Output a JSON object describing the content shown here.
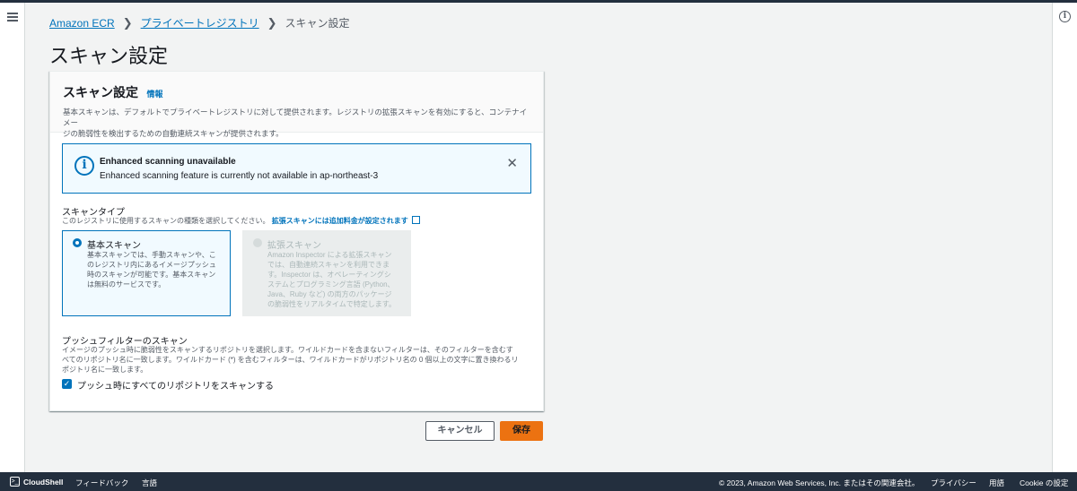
{
  "breadcrumb": {
    "root": "Amazon ECR",
    "parent": "プライベートレジストリ",
    "current": "スキャン設定"
  },
  "page_title": "スキャン設定",
  "card": {
    "title": "スキャン設定",
    "info_link": "情報",
    "desc_line1": "基本スキャンは、デフォルトでプライベートレジストリに対して提供されます。レジストリの拡張スキャンを有効にすると、コンテナイメー",
    "desc_line2": "ジの脆弱性を検出するための自動連続スキャンが提供されます。"
  },
  "alert": {
    "title": "Enhanced scanning unavailable",
    "message": "Enhanced scanning feature is currently not available in ap-northeast-3"
  },
  "scan_type": {
    "label": "スキャンタイプ",
    "desc": "このレジストリに使用するスキャンの種類を選択してください。",
    "link": "拡張スキャンには追加料金が設定されます",
    "basic": {
      "label": "基本スキャン",
      "line1": "基本スキャンでは、手動スキャンや、こ",
      "line2": "のレジストリ内にあるイメージプッシュ",
      "line3": "時のスキャンが可能です。基本スキャン",
      "line4": "は無料のサービスです。",
      "selected": true
    },
    "enhanced": {
      "label": "拡張スキャン",
      "line1": "Amazon Inspector による拡張スキャン",
      "line2": "では、自動連続スキャンを利用できま",
      "line3": "す。Inspector は、オペレーティングシ",
      "line4": "ステムとプログラミング言語 (Python、",
      "line5": "Java、Ruby など) の両方のパッケージ",
      "line6": "の脆弱性をリアルタイムで特定します。",
      "disabled": true
    }
  },
  "push_filter": {
    "label": "プッシュフィルターのスキャン",
    "line1": "イメージのプッシュ時に脆弱性をスキャンするリポジトリを選択します。ワイルドカードを含まないフィルターは、そのフィルターを含むす",
    "line2": "べてのリポジトリ名に一致します。ワイルドカード (*) を含むフィルターは、ワイルドカードがリポジトリ名の 0 個以上の文字に置き換わるリ",
    "line3": "ポジトリ名に一致します。",
    "checkbox_label": "プッシュ時にすべてのリポジトリをスキャンする",
    "checked": true
  },
  "buttons": {
    "cancel": "キャンセル",
    "save": "保存"
  },
  "footer": {
    "cloudshell": "CloudShell",
    "feedback": "フィードバック",
    "language": "言語",
    "copyright": "© 2023, Amazon Web Services, Inc. またはその関連会社。",
    "privacy": "プライバシー",
    "terms": "用語",
    "cookie": "Cookie の設定"
  },
  "colors": {
    "accent": "#0073bb",
    "save": "#ec7211",
    "footer_bg": "#232f3e"
  }
}
